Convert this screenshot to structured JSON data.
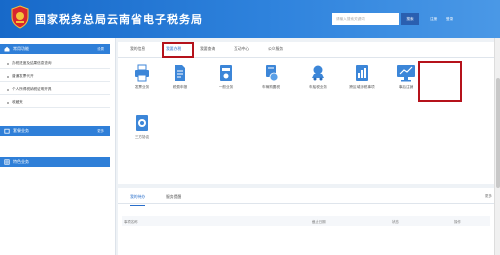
{
  "header": {
    "title": "国家税务总局云南省电子税务局",
    "search_placeholder": "请输入搜索关键词",
    "search_button": "搜索",
    "link1": "注册",
    "link2": "登录"
  },
  "sidebar": {
    "sections": [
      {
        "label": "常用功能",
        "tail": "设置"
      },
      {
        "label": "套餐业务",
        "tail": "更多"
      },
      {
        "label": "特色业务",
        "tail": ""
      }
    ],
    "items": [
      "办税进度及结果信息查询",
      "普通发票代开",
      "个人所得税纳税证明开具",
      "收藏夹"
    ]
  },
  "main": {
    "tabs": [
      "我的信息",
      "我要办税",
      "我要查询",
      "互动中心",
      "公众服务"
    ],
    "tiles": [
      "发票业务",
      "税费申报",
      "一般业务",
      "车辆购置税",
      "车船税业务",
      "跨区域涉税事项",
      "事后注销",
      "三方协议"
    ],
    "tabs2": [
      "我的待办",
      "服务提醒"
    ],
    "more": "更多",
    "table_headers": [
      "事项名称",
      "截止日期",
      "状态",
      "操作"
    ]
  },
  "colors": {
    "accent": "#2a6fcb",
    "highlight": "#b5121b",
    "header": "#1769c9"
  }
}
